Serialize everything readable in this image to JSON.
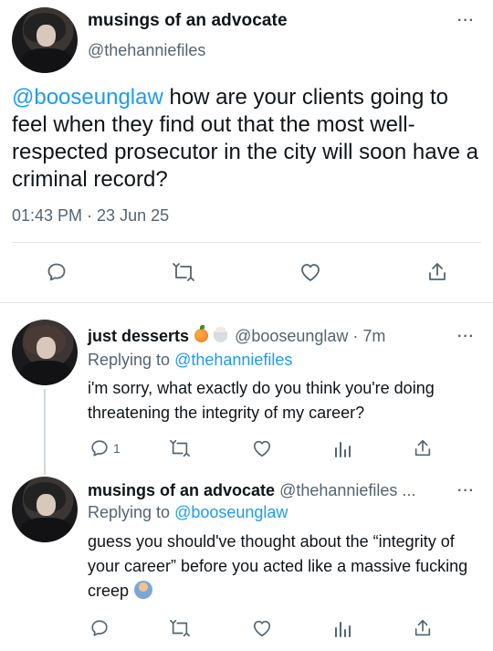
{
  "main_tweet": {
    "display_name": "musings of an advocate",
    "handle": "@thehanniefiles",
    "mention": "@booseunglaw",
    "text": " how are your clients going to feel when they find out that the most well-respected prosecutor in the city will soon have a criminal record?",
    "timestamp": "01:43 PM · 23 Jun 25",
    "more": "···"
  },
  "replies": [
    {
      "display_name": "just desserts",
      "emoji": [
        "tangerine-emoji",
        "ice-cream-cup-emoji"
      ],
      "handle_time": "@booseunglaw · 7m",
      "replying_label": "Replying to ",
      "replying_to": "@thehanniefiles",
      "text": "i'm sorry, what exactly do you think you're doing threatening the integrity of my career?",
      "reply_count": "1",
      "more": "···"
    },
    {
      "display_name": "musings of an advocate",
      "handle_time": "@thehanniefiles ...",
      "replying_label": "Replying to ",
      "replying_to": "@booseunglaw",
      "text": "guess you should've thought about the “integrity of your career” before you acted like a massive fucking creep",
      "emoji": [
        "person-shrugging-emoji"
      ],
      "more": "···"
    }
  ],
  "colors": {
    "accent": "#1d9bf0",
    "text": "#0f1419",
    "secondary": "#536471",
    "divider": "#e1e5e9"
  },
  "icons": [
    "reply-icon",
    "retweet-icon",
    "like-icon",
    "share-icon",
    "analytics-icon"
  ]
}
